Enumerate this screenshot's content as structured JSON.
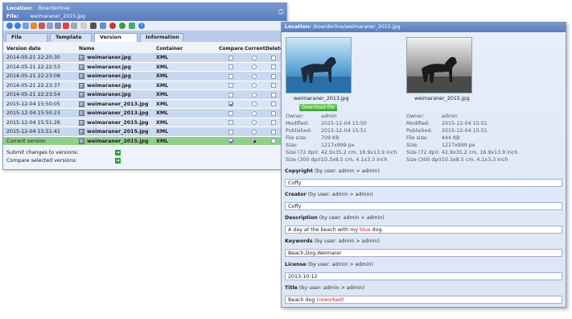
{
  "left_window": {
    "location_label": "Location:",
    "location_value": "/boarderline/",
    "file_label": "File:",
    "file_value": "weimaraner_2015.jpg",
    "toolbar_icons": [
      "back-icon",
      "forward-icon",
      "refresh-icon",
      "home-icon",
      "cut-icon",
      "copy-icon",
      "paste-icon",
      "delete-icon",
      "upload-icon",
      "lock-icon",
      "tools-icon",
      "color-icon",
      "palette-icon",
      "settings-icon",
      "history-icon",
      "help-icon"
    ],
    "tabs": [
      {
        "label": "File"
      },
      {
        "label": "Template"
      },
      {
        "label": "Version",
        "selected": true
      },
      {
        "label": "Information"
      }
    ],
    "columns": {
      "version_date": "Version date",
      "name": "Name",
      "container": "Container",
      "compare": "Compare",
      "current": "Current",
      "delete": "Delete"
    },
    "rows": [
      {
        "date": "2014-05-21 22:20:30",
        "name": "weimaraner.jpg",
        "container": "XML",
        "compare": false,
        "current": false
      },
      {
        "date": "2014-05-21 22:22:53",
        "name": "weimaraner.jpg",
        "container": "XML",
        "compare": false,
        "current": false
      },
      {
        "date": "2014-05-21 22:23:08",
        "name": "weimaraner.jpg",
        "container": "XML",
        "compare": false,
        "current": false
      },
      {
        "date": "2014-05-21 22:23:37",
        "name": "weimaraner.jpg",
        "container": "XML",
        "compare": false,
        "current": false
      },
      {
        "date": "2014-05-21 22:23:54",
        "name": "weimaraner.jpg",
        "container": "XML",
        "compare": false,
        "current": false
      },
      {
        "date": "2015-12-04 15:50:05",
        "name": "weimaraner_2013.jpg",
        "container": "XML",
        "compare": true,
        "current": false
      },
      {
        "date": "2015-12-04 15:50:23",
        "name": "weimaraner_2013.jpg",
        "container": "XML",
        "compare": false,
        "current": false
      },
      {
        "date": "2015-12-04 15:51:26",
        "name": "weimaraner_2015.jpg",
        "container": "XML",
        "compare": false,
        "current": false
      },
      {
        "date": "2015-12-04 15:51:41",
        "name": "weimaraner_2015.jpg",
        "container": "XML",
        "compare": false,
        "current": false
      },
      {
        "date": "Current version",
        "name": "weimaraner_2015.jpg",
        "container": "XML",
        "compare": true,
        "current": true,
        "highlight": true
      }
    ],
    "submit_label": "Submit changes to versions:",
    "compare_label": "Compare selected versions:"
  },
  "right_window": {
    "location_label": "Location:",
    "location_value": "/boarderline/weimaraner_2015.jpg",
    "left_image": {
      "caption": "weimaraner_2013.jpg",
      "download": "Download file",
      "owner": {
        "label": "Owner:",
        "value": "admin"
      },
      "modified": {
        "label": "Modified:",
        "value": "2015-12-04 15:50"
      },
      "published": {
        "label": "Published:",
        "value": "2015-12-04 15:51"
      },
      "filesize": {
        "label": "File size:",
        "value": "709 KB"
      },
      "size": {
        "label": "Size:",
        "value": "1217x999 px"
      },
      "size72": {
        "label": "Size (72 dpi):",
        "value": "42.9x35.2 cm, 16.9x13.9 inch"
      },
      "size300": {
        "label": "Size (300 dpi):",
        "value": "10.3x8.5 cm, 4.1x3.3 inch"
      }
    },
    "right_image": {
      "caption": "weimaraner_2015.jpg",
      "owner": {
        "label": "Owner:",
        "value": "admin"
      },
      "modified": {
        "label": "Modified:",
        "value": "2015-12-04 15:51"
      },
      "published": {
        "label": "Published:",
        "value": "2015-12-04 15:51"
      },
      "filesize": {
        "label": "File size:",
        "value": "444 KB"
      },
      "size": {
        "label": "Size:",
        "value": "1217x999 px"
      },
      "size72": {
        "label": "Size (72 dpi):",
        "value": "42.9x35.2 cm, 16.9x13.9 inch"
      },
      "size300": {
        "label": "Size (300 dpi):",
        "value": "10.3x8.5 cm, 4.1x3.3 inch"
      }
    },
    "fields": {
      "copyright": {
        "label": "Copyright",
        "by": "(by user: admin > admin)",
        "value": "Coffy"
      },
      "creator": {
        "label": "Creator",
        "by": "(by user: admin > admin)",
        "value": "Coffy"
      },
      "description": {
        "label": "Description",
        "by": "(by user: admin > admin)",
        "value_pre": "A day at the beach with my ",
        "value_mark": "blue",
        "value_post": " dog."
      },
      "keywords": {
        "label": "Keywords",
        "by": "(by user: admin > admin)",
        "value": "Beach,Dog,Weimarer"
      },
      "license": {
        "label": "License",
        "by": "(by user: admin > admin)",
        "value": "2013-10-12"
      },
      "title": {
        "label": "Title",
        "by": "(by user: admin > admin)",
        "value_pre": "Beach dog ",
        "value_mark": "(reworked)"
      }
    },
    "colors": {
      "header": "#5a7cbd",
      "highlight_row": "#8fd08a",
      "download": "#3f9e33",
      "diff": "#d32020"
    }
  }
}
